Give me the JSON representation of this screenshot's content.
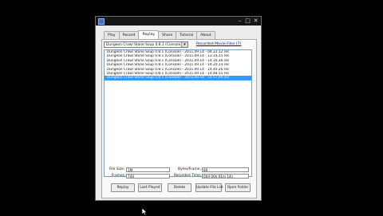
{
  "window": {
    "title": "",
    "controls": {
      "minimize": "–",
      "maximize": "□",
      "close": "✕"
    }
  },
  "tabs": [
    {
      "label": "Play",
      "active": false
    },
    {
      "label": "Record",
      "active": false
    },
    {
      "label": "Replay",
      "active": true
    },
    {
      "label": "Share",
      "active": false
    },
    {
      "label": "Tutorial",
      "active": false
    },
    {
      "label": "About",
      "active": false
    }
  ],
  "replay": {
    "game_select_value": "Dungeon Crawl Stone Soup 0.8.1 (Console)",
    "recorded_movie_files_label": "Recorded Movie Files (7)",
    "files": [
      {
        "name": "Dungeon Crawl Stone Soup 0.8.1 (Console) - 2011.09.14 - 04.22.12.rec",
        "selected": false
      },
      {
        "name": "Dungeon Crawl Stone Soup 0.8.1 (Console) - 2011.09.14 - 13.14.25.rec",
        "selected": false
      },
      {
        "name": "Dungeon Crawl Stone Soup 0.8.1 (Console) - 2011.09.14 - 14.16.36.rec",
        "selected": false
      },
      {
        "name": "Dungeon Crawl Stone Soup 0.8.1 (Console) - 2011.09.14 - 14.20.13.rec",
        "selected": false
      },
      {
        "name": "Dungeon Crawl Stone Soup 0.8.1 (Console) - 2011.09.14 - 14.40.26.rec",
        "selected": false
      },
      {
        "name": "Dungeon Crawl Stone Soup 0.8.1 (Console) - 2011.09.14 - 14.48.55.rec",
        "selected": false
      },
      {
        "name": "Dungeon Crawl Stone Soup 0.8.1 (Console) - 2011.09.14 - 14.57.09.rec",
        "selected": true
      }
    ],
    "details": {
      "file_size_label": "File Size:",
      "file_size_value": "1M",
      "frames_label": "Frames:",
      "frames_value": "740",
      "bytes_frame_label": "Bytes/Frame:",
      "bytes_frame_value": "80",
      "recorded_time_label": "Recorded Time:",
      "recorded_time_value": "00d 00h 01m 14s"
    },
    "buttons": {
      "replay": "Replay",
      "last_played": "Last Played",
      "delete": "Delete",
      "update_file_list": "Update File List",
      "open_folder": "Open Folder"
    }
  },
  "colors": {
    "selection": "#3399ff",
    "window_bg": "#ececec",
    "titlebar": "#161616",
    "screen_bg": "#000000"
  }
}
